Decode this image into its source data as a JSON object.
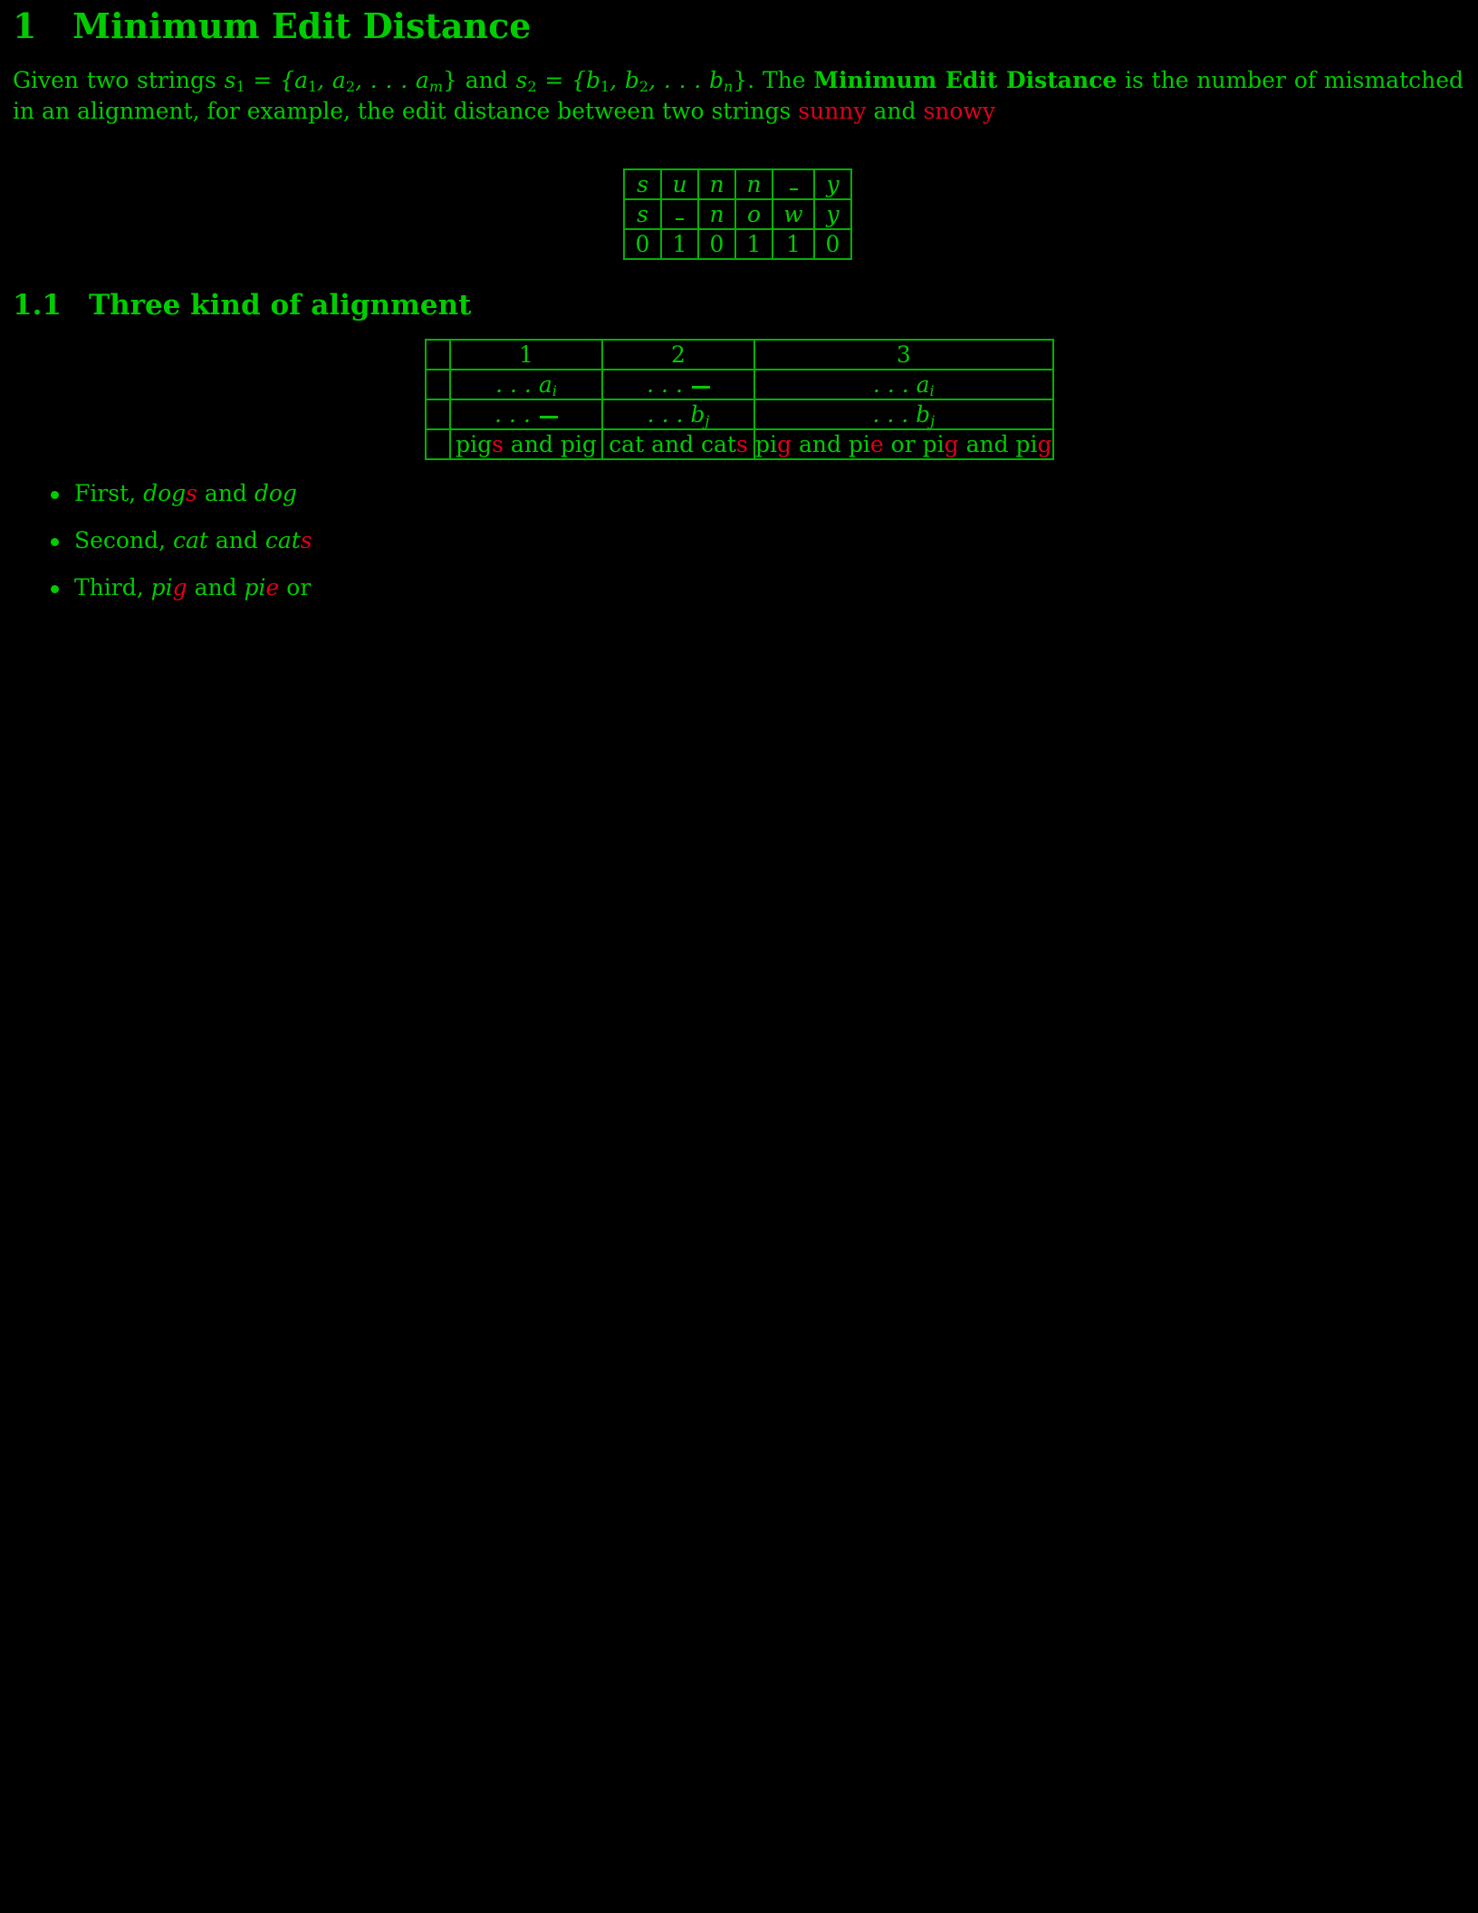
{
  "colors": {
    "text": "#00cc00",
    "highlight": "#e0001a",
    "background": "#000000"
  },
  "section": {
    "number": "1",
    "title": "Minimum Edit Distance"
  },
  "intro": {
    "p1": "Given two strings ",
    "s1": "s",
    "s1_sub": "1",
    "eq1": " = {a",
    "a1_sub": "1",
    "comma1": ", a",
    "a2_sub": "2",
    "dots1": ", . . . a",
    "am_sub": "m",
    "close1": "} and ",
    "s2": "s",
    "s2_sub": "2",
    "eq2": " = {b",
    "b1_sub": "1",
    "comma2": ", b",
    "b2_sub": "2",
    "dots2": ", . . . b",
    "bn_sub": "n",
    "close2": "}.  The ",
    "bold": "Minimum Edit Distance",
    "p2": " is the number of mismatched in an alignment, for example, the edit distance between two strings ",
    "word1": "sunny",
    "and": " and ",
    "word2": "snowy"
  },
  "alignment_table": {
    "row1": [
      "s",
      "u",
      "n",
      "n",
      "_",
      "y"
    ],
    "row2": [
      "s",
      "_",
      "n",
      "o",
      "w",
      "y"
    ],
    "row3": [
      "0",
      "1",
      "0",
      "1",
      "1",
      "0"
    ]
  },
  "subsection": {
    "number": "1.1",
    "title": "Three kind of alignment"
  },
  "kind_table": {
    "headers": [
      "",
      "1",
      "2",
      "3"
    ],
    "row_a": {
      "c1": ". . . a",
      "c1_sub": "i",
      "c2": ". . . ",
      "c3": ". . . a",
      "c3_sub": "i"
    },
    "row_b": {
      "c1": ". . . ",
      "c2": ". . . b",
      "c2_sub": "j",
      "c3": ". . . b",
      "c3_sub": "j"
    },
    "row_c": {
      "c1_a": "pig",
      "c1_b": "s",
      "c1_c": " and pig",
      "c2_a": "cat and cat",
      "c2_b": "s",
      "c3_a": "pi",
      "c3_b": "g",
      "c3_c": " and pi",
      "c3_d": "e",
      "c3_e": " or pi",
      "c3_f": "g",
      "c3_g": " and pi",
      "c3_h": "g"
    }
  },
  "bullets": [
    {
      "lead": "First, ",
      "w1a": "dog",
      "w1b": "s",
      "mid": " and ",
      "w2": "dog"
    },
    {
      "lead": "Second, ",
      "w1": "cat",
      "mid": " and ",
      "w2a": "cat",
      "w2b": "s"
    },
    {
      "lead": "Third, ",
      "w1a": "pi",
      "w1b": "g",
      "mid": " and ",
      "w2a": "pi",
      "w2b": "e",
      "tail": " or"
    }
  ]
}
